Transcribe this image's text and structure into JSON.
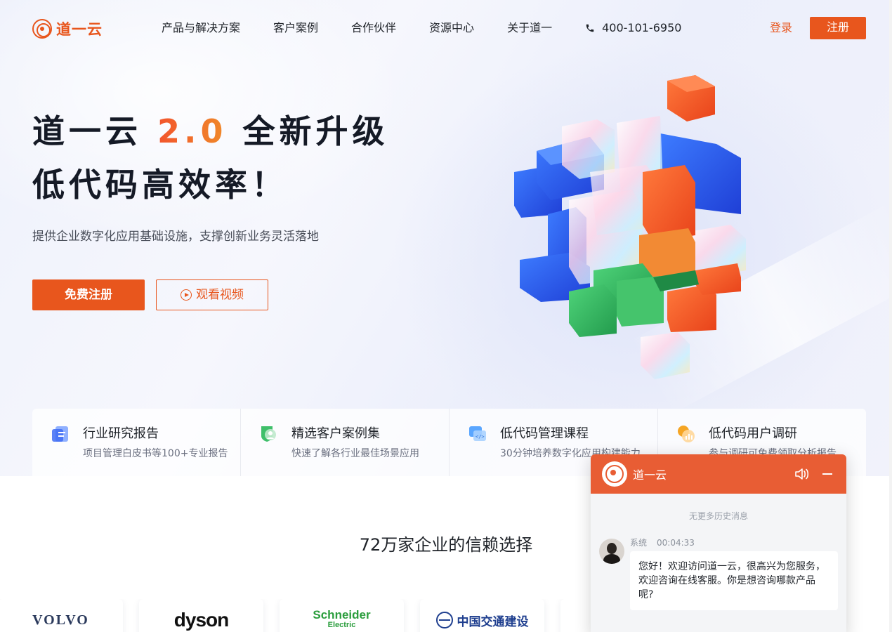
{
  "brand": {
    "logo_text": "道一云",
    "accent": "#e8561d"
  },
  "nav": {
    "items": [
      "产品与解决方案",
      "客户案例",
      "合作伙伴",
      "资源中心",
      "关于道一"
    ],
    "phone": "400-101-6950",
    "login": "登录",
    "register": "注册"
  },
  "hero": {
    "title_prefix": "道一云 ",
    "title_highlight": "2.0",
    "title_suffix": " 全新升级",
    "title_line2": "低代码高效率！",
    "subtitle": "提供企业数字化应用基础设施，支撑创新业务灵活落地",
    "btn_free": "免费注册",
    "btn_video": "观看视频"
  },
  "features": [
    {
      "title": "行业研究报告",
      "desc": "项目管理白皮书等100+专业报告",
      "icon": "report-icon"
    },
    {
      "title": "精选客户案例集",
      "desc": "快速了解各行业最佳场景应用",
      "icon": "case-icon"
    },
    {
      "title": "低代码管理课程",
      "desc": "30分钟培养数字化应用构建能力",
      "icon": "course-icon"
    },
    {
      "title": "低代码用户调研",
      "desc": "参与调研可免费领取分析报告",
      "icon": "survey-icon"
    }
  ],
  "trust": {
    "title": "72万家企业的信赖选择",
    "logos": [
      "VOLVO",
      "dyson",
      "Schneider",
      "Electric",
      "中国交通建设"
    ]
  },
  "chat": {
    "name": "道一云",
    "no_more": "无更多历史消息",
    "sender": "系统",
    "time": "00:04:33",
    "message": "您好！欢迎访问道一云，很高兴为您服务，欢迎咨询在线客服。你是想咨询哪款产品呢?"
  }
}
